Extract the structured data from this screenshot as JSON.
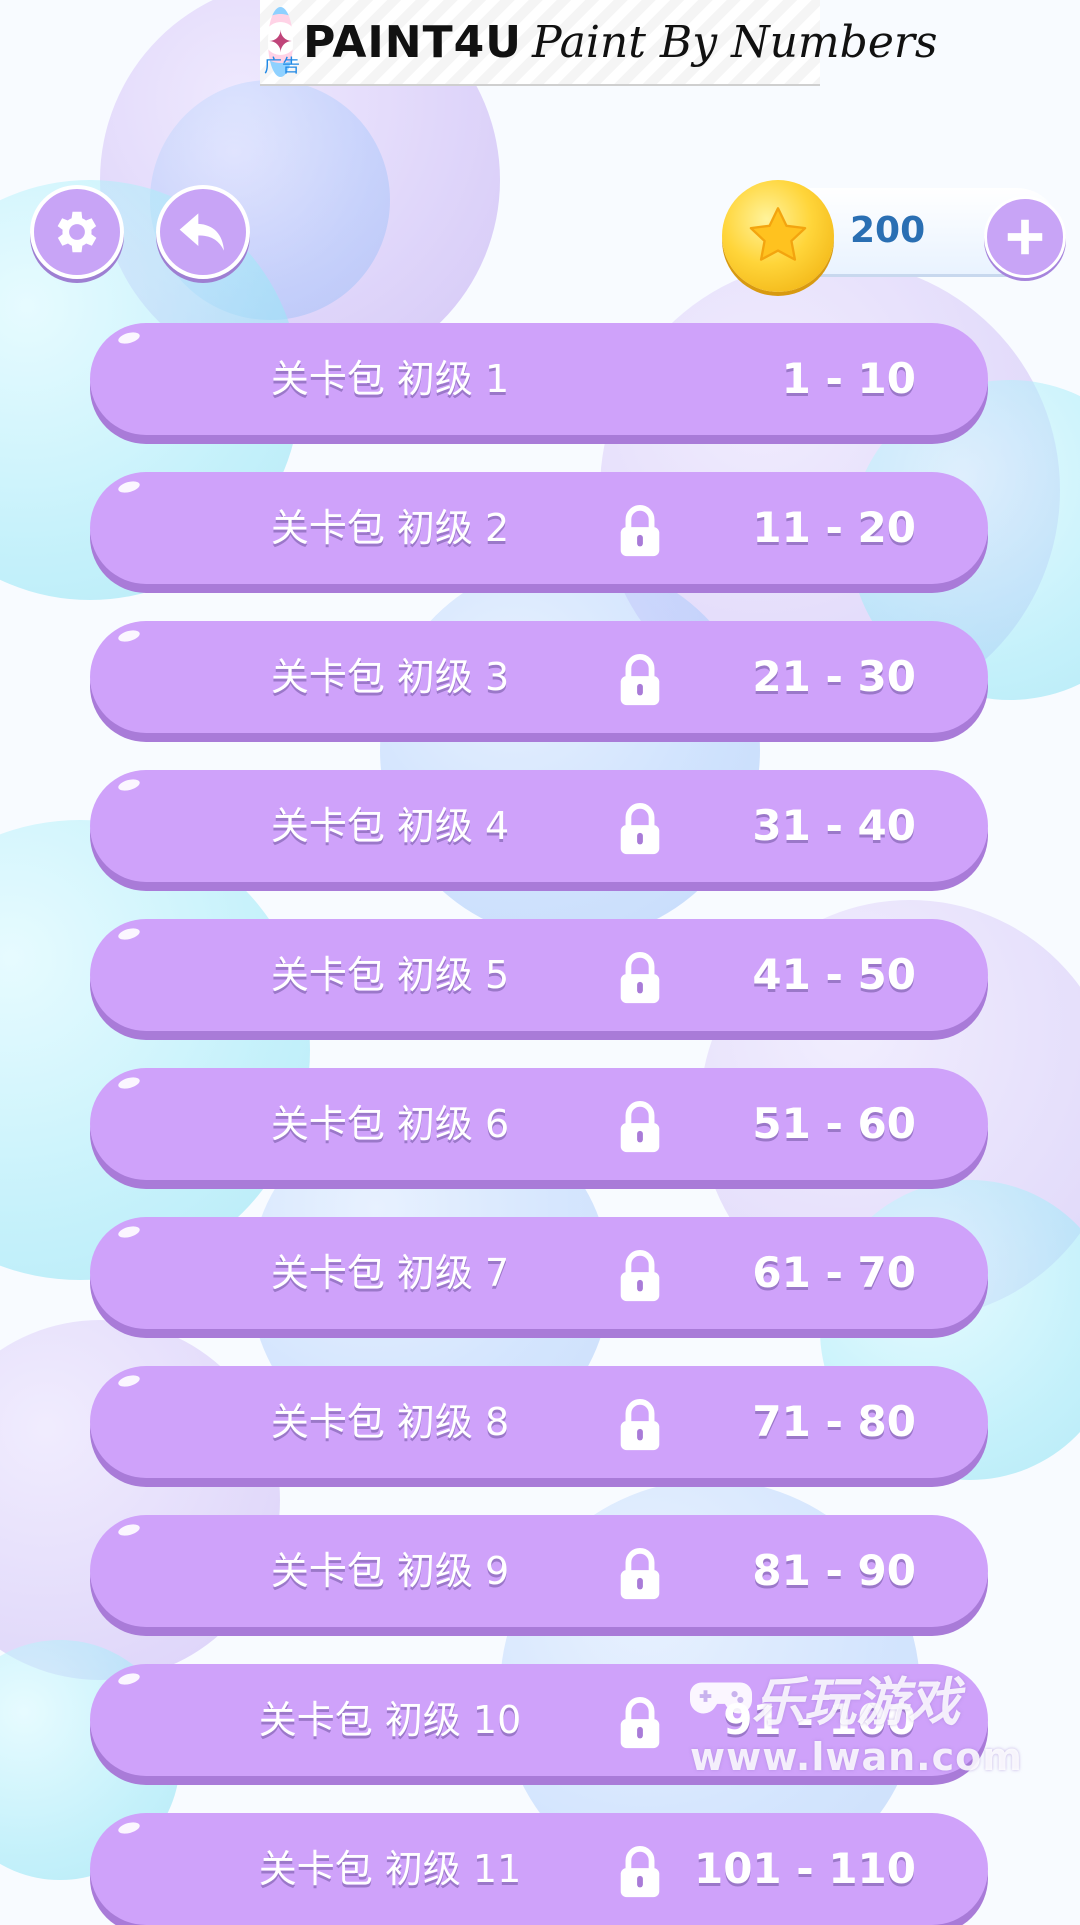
{
  "ad": {
    "brand": "PAINT4U",
    "tagline": "Paint By Numbers",
    "label": "广告"
  },
  "header": {
    "settings_icon": "gear-icon",
    "back_icon": "back-arrow-icon",
    "coins": "200",
    "coin_icon": "star-coin-icon",
    "add_icon": "plus-icon"
  },
  "packs": [
    {
      "name": "关卡包 初级 1",
      "range": "1 - 10",
      "locked": false
    },
    {
      "name": "关卡包 初级 2",
      "range": "11 - 20",
      "locked": true
    },
    {
      "name": "关卡包 初级 3",
      "range": "21 - 30",
      "locked": true
    },
    {
      "name": "关卡包 初级 4",
      "range": "31 - 40",
      "locked": true
    },
    {
      "name": "关卡包 初级 5",
      "range": "41 - 50",
      "locked": true
    },
    {
      "name": "关卡包 初级 6",
      "range": "51 - 60",
      "locked": true
    },
    {
      "name": "关卡包 初级 7",
      "range": "61 - 70",
      "locked": true
    },
    {
      "name": "关卡包 初级 8",
      "range": "71 - 80",
      "locked": true
    },
    {
      "name": "关卡包 初级 9",
      "range": "81 - 90",
      "locked": true
    },
    {
      "name": "关卡包 初级 10",
      "range": "91 - 100",
      "locked": true
    },
    {
      "name": "关卡包 初级 11",
      "range": "101 - 110",
      "locked": true
    }
  ],
  "watermark": {
    "text": "乐玩游戏",
    "url": "www.lwan.com"
  },
  "colors": {
    "pack": "#cfa2fa",
    "button": "#c8a4f6",
    "coin_text": "#2a6fb3"
  }
}
